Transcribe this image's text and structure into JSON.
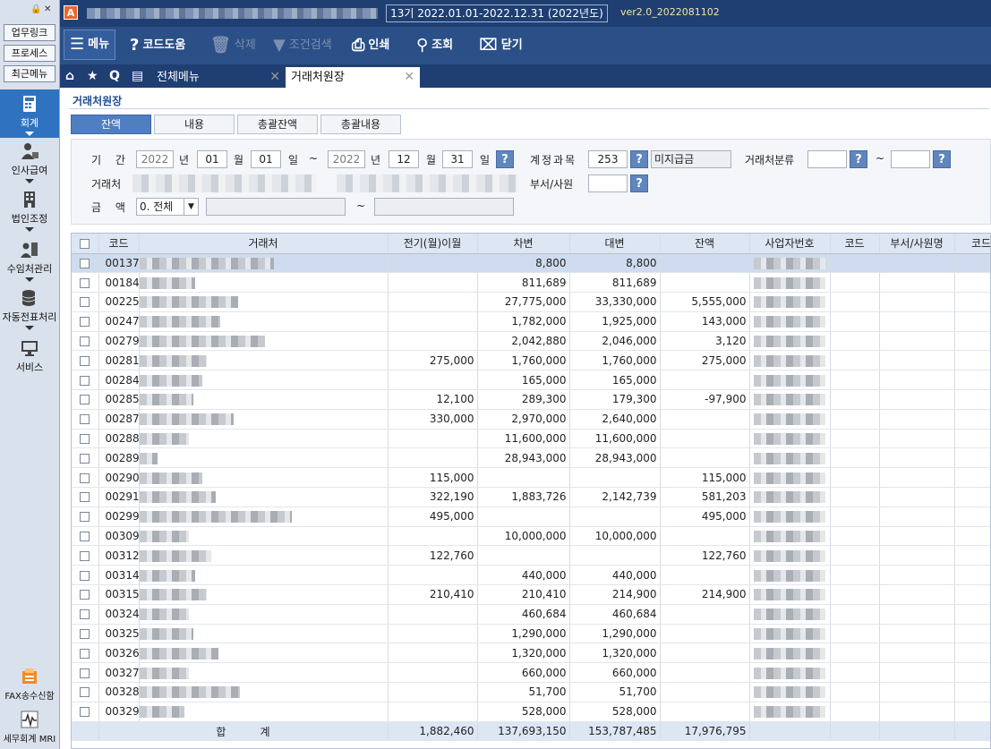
{
  "sidebar": {
    "links": [
      "업무링크",
      "프로세스",
      "최근메뉴"
    ],
    "menus": [
      {
        "label": "회계",
        "icon": "calculator-icon",
        "active": true
      },
      {
        "label": "인사급여",
        "icon": "person-money-icon",
        "active": false
      },
      {
        "label": "법인조정",
        "icon": "building-icon",
        "active": false
      },
      {
        "label": "수임처관리",
        "icon": "people-building-icon",
        "active": false
      },
      {
        "label": "자동전표처리",
        "icon": "database-icon",
        "active": false
      },
      {
        "label": "서비스",
        "icon": "monitor-icon",
        "active": false
      }
    ],
    "bottom": [
      {
        "label": "FAX송수신함",
        "icon": "fax-icon"
      },
      {
        "label": "세무회계 MRI",
        "icon": "pulse-icon"
      }
    ]
  },
  "titlebar": {
    "period": "13기  2022.01.01-2022.12.31  (2022년도)",
    "version": "ver2.0_2022081102"
  },
  "toolbar": {
    "menu": "메뉴",
    "code_help": "코드도움",
    "delete": "삭제",
    "condition_search": "조건검색",
    "print": "인쇄",
    "lookup": "조회",
    "close": "닫기"
  },
  "tabs": [
    {
      "label": "전체메뉴",
      "active": false
    },
    {
      "label": "거래처원장",
      "active": true
    }
  ],
  "page": {
    "title": "거래처원장",
    "subtabs": [
      "잔액",
      "내용",
      "총괄잔액",
      "총괄내용"
    ]
  },
  "filter": {
    "period_label": "기  간",
    "from_year": "2022",
    "from_month": "01",
    "from_day": "01",
    "to_year": "2022",
    "to_month": "12",
    "to_day": "31",
    "unit_year": "년",
    "unit_month": "월",
    "unit_day": "일",
    "tilde": "~",
    "account_label": "계정과목",
    "account_code": "253",
    "account_name": "미지급금",
    "class_label": "거래처분류",
    "partner_label": "거래처",
    "dept_label": "부서/사원",
    "amount_label": "금  액",
    "amount_select": "0. 전체",
    "q": "?"
  },
  "grid": {
    "headers": [
      "코드",
      "거래처",
      "전기(월)이월",
      "차변",
      "대변",
      "잔액",
      "사업자번호",
      "코드",
      "부서/사원명",
      "코드"
    ],
    "rows": [
      {
        "code": "00137",
        "prev": "",
        "debit": "8,800",
        "credit": "8,800",
        "balance": ""
      },
      {
        "code": "00184",
        "prev": "",
        "debit": "811,689",
        "credit": "811,689",
        "balance": ""
      },
      {
        "code": "00225",
        "prev": "",
        "debit": "27,775,000",
        "credit": "33,330,000",
        "balance": "5,555,000"
      },
      {
        "code": "00247",
        "prev": "",
        "debit": "1,782,000",
        "credit": "1,925,000",
        "balance": "143,000"
      },
      {
        "code": "00279",
        "prev": "",
        "debit": "2,042,880",
        "credit": "2,046,000",
        "balance": "3,120"
      },
      {
        "code": "00281",
        "prev": "275,000",
        "debit": "1,760,000",
        "credit": "1,760,000",
        "balance": "275,000"
      },
      {
        "code": "00284",
        "prev": "",
        "debit": "165,000",
        "credit": "165,000",
        "balance": ""
      },
      {
        "code": "00285",
        "prev": "12,100",
        "debit": "289,300",
        "credit": "179,300",
        "balance": "-97,900"
      },
      {
        "code": "00287",
        "prev": "330,000",
        "debit": "2,970,000",
        "credit": "2,640,000",
        "balance": ""
      },
      {
        "code": "00288",
        "prev": "",
        "debit": "11,600,000",
        "credit": "11,600,000",
        "balance": ""
      },
      {
        "code": "00289",
        "prev": "",
        "debit": "28,943,000",
        "credit": "28,943,000",
        "balance": ""
      },
      {
        "code": "00290",
        "prev": "115,000",
        "debit": "",
        "credit": "",
        "balance": "115,000"
      },
      {
        "code": "00291",
        "prev": "322,190",
        "debit": "1,883,726",
        "credit": "2,142,739",
        "balance": "581,203"
      },
      {
        "code": "00299",
        "prev": "495,000",
        "debit": "",
        "credit": "",
        "balance": "495,000"
      },
      {
        "code": "00309",
        "prev": "",
        "debit": "10,000,000",
        "credit": "10,000,000",
        "balance": ""
      },
      {
        "code": "00312",
        "prev": "122,760",
        "debit": "",
        "credit": "",
        "balance": "122,760"
      },
      {
        "code": "00314",
        "prev": "",
        "debit": "440,000",
        "credit": "440,000",
        "balance": ""
      },
      {
        "code": "00315",
        "prev": "210,410",
        "debit": "210,410",
        "credit": "214,900",
        "balance": "214,900"
      },
      {
        "code": "00324",
        "prev": "",
        "debit": "460,684",
        "credit": "460,684",
        "balance": ""
      },
      {
        "code": "00325",
        "prev": "",
        "debit": "1,290,000",
        "credit": "1,290,000",
        "balance": ""
      },
      {
        "code": "00326",
        "prev": "",
        "debit": "1,320,000",
        "credit": "1,320,000",
        "balance": ""
      },
      {
        "code": "00327",
        "prev": "",
        "debit": "660,000",
        "credit": "660,000",
        "balance": ""
      },
      {
        "code": "00328",
        "prev": "",
        "debit": "51,700",
        "credit": "51,700",
        "balance": ""
      },
      {
        "code": "00329",
        "prev": "",
        "debit": "528,000",
        "credit": "528,000",
        "balance": ""
      }
    ],
    "total": {
      "label": "합          계",
      "prev": "1,882,460",
      "debit": "137,693,150",
      "credit": "153,787,485",
      "balance": "17,976,795"
    }
  }
}
